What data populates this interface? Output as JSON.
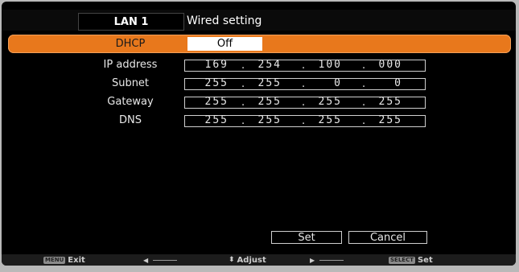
{
  "header": {
    "tab": "LAN 1",
    "title": "Wired setting"
  },
  "dhcp": {
    "label": "DHCP",
    "value": "Off"
  },
  "fields": [
    {
      "label": "IP address",
      "octets": [
        "169",
        "254",
        "100",
        "000"
      ]
    },
    {
      "label": "Subnet",
      "octets": [
        "255",
        "255",
        "0",
        "0"
      ]
    },
    {
      "label": "Gateway",
      "octets": [
        "255",
        "255",
        "255",
        "255"
      ]
    },
    {
      "label": "DNS",
      "octets": [
        "255",
        "255",
        "255",
        "255"
      ]
    }
  ],
  "separator": ".",
  "buttons": {
    "set": "Set",
    "cancel": "Cancel"
  },
  "footer": {
    "menu_key": "MENU",
    "exit": "Exit",
    "adjust": "Adjust",
    "select_key": "SELECT",
    "set": "Set"
  },
  "colors": {
    "highlight": "#e8781c",
    "background": "#000000"
  }
}
